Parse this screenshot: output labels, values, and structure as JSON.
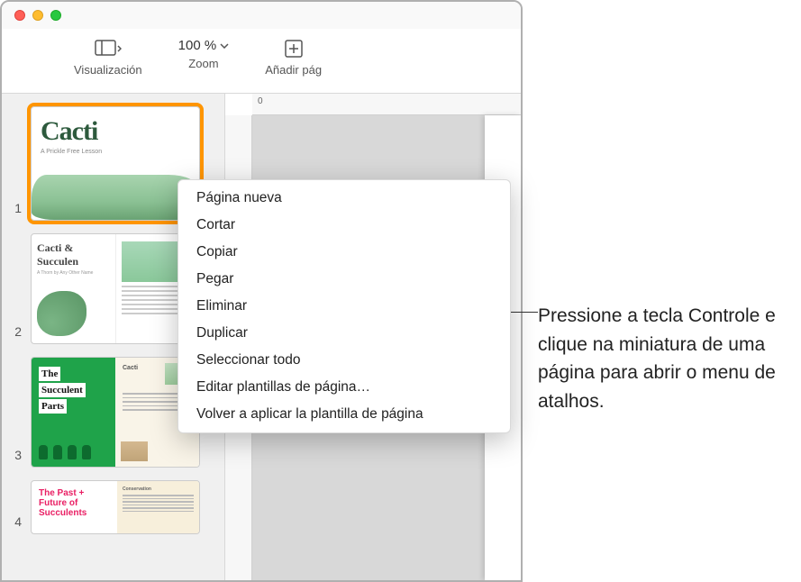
{
  "toolbar": {
    "view_label": "Visualización",
    "zoom_label": "Zoom",
    "zoom_value": "100 %",
    "add_page_label": "Añadir pág"
  },
  "ruler": {
    "tick0": "0"
  },
  "sidebar": {
    "thumbs": [
      {
        "num": "1",
        "title": "Cacti",
        "subtitle": "A Prickle Free Lesson"
      },
      {
        "num": "2",
        "title": "Cacti & Succulen",
        "subtitle": "A Thorn by Any Other Name"
      },
      {
        "num": "3",
        "title_l1": "The",
        "title_l2": "Succulent",
        "title_l3": "Parts",
        "right_heading": "Cacti"
      },
      {
        "num": "4",
        "title_l1": "The Past +",
        "title_l2": "Future of",
        "title_l3": "Succulents",
        "right_heading": "Conservation"
      }
    ]
  },
  "context_menu": {
    "items": [
      "Página nueva",
      "Cortar",
      "Copiar",
      "Pegar",
      "Eliminar",
      "Duplicar",
      "Seleccionar todo",
      "Editar plantillas de página…",
      "Volver a aplicar la plantilla de página"
    ]
  },
  "callout": {
    "text": "Pressione a tecla Controle e clique na miniatura de uma página para abrir o menu de atalhos."
  }
}
